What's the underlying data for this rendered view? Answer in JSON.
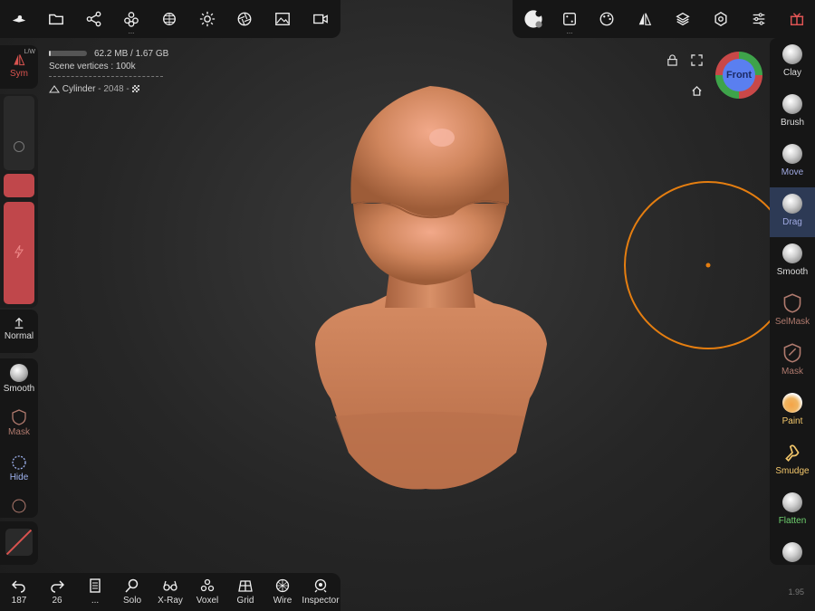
{
  "top_left_toolbar": [
    "scene-icon",
    "folder-icon",
    "share-icon",
    "spheres-icon",
    "grid-sphere-icon",
    "sun-icon",
    "aperture-icon",
    "image-icon",
    "camera-icon"
  ],
  "top_right_toolbar": [
    "matcap-icon",
    "random-icon",
    "palette-icon",
    "symmetry-icon",
    "layers-icon",
    "settings-icon",
    "sliders-icon",
    "gift-icon"
  ],
  "info": {
    "memory": "62.2 MB / 1.67 GB",
    "memory_fraction": 0.037,
    "scene_vertices": "Scene vertices : 100k",
    "object_name": "Cylinder",
    "object_detail": "- 2048 -"
  },
  "left_sidebar": {
    "sym_label": "Sym",
    "sym_badge": "L/W",
    "normal_label": "Normal",
    "smooth_label": "Smooth",
    "mask_label": "Mask",
    "hide_label": "Hide",
    "slider_color": "#c0474b"
  },
  "right_sidebar": {
    "tools": [
      {
        "label": "Clay",
        "color": "#dddddd"
      },
      {
        "label": "Brush",
        "color": "#dddddd"
      },
      {
        "label": "Move",
        "color": "#9fa8e0"
      },
      {
        "label": "Drag",
        "color": "#9fa8e0"
      },
      {
        "label": "Smooth",
        "color": "#dddddd"
      },
      {
        "label": "SelMask",
        "color": "#b07a6e"
      },
      {
        "label": "Mask",
        "color": "#b07a6e"
      },
      {
        "label": "Paint",
        "color": "#f3c76b"
      },
      {
        "label": "Smudge",
        "color": "#f3c76b"
      },
      {
        "label": "Flatten",
        "color": "#6fd16f"
      }
    ]
  },
  "view_cube": {
    "label": "Front"
  },
  "bottom_bar": {
    "undo_count": "187",
    "redo_count": "26",
    "more": "...",
    "solo": "Solo",
    "xray": "X-Ray",
    "voxel": "Voxel",
    "grid": "Grid",
    "wire": "Wire",
    "inspector": "Inspector"
  },
  "version": "1.95",
  "accent_colors": {
    "brush_cursor": "#e57e10",
    "model": "#c67b52"
  }
}
